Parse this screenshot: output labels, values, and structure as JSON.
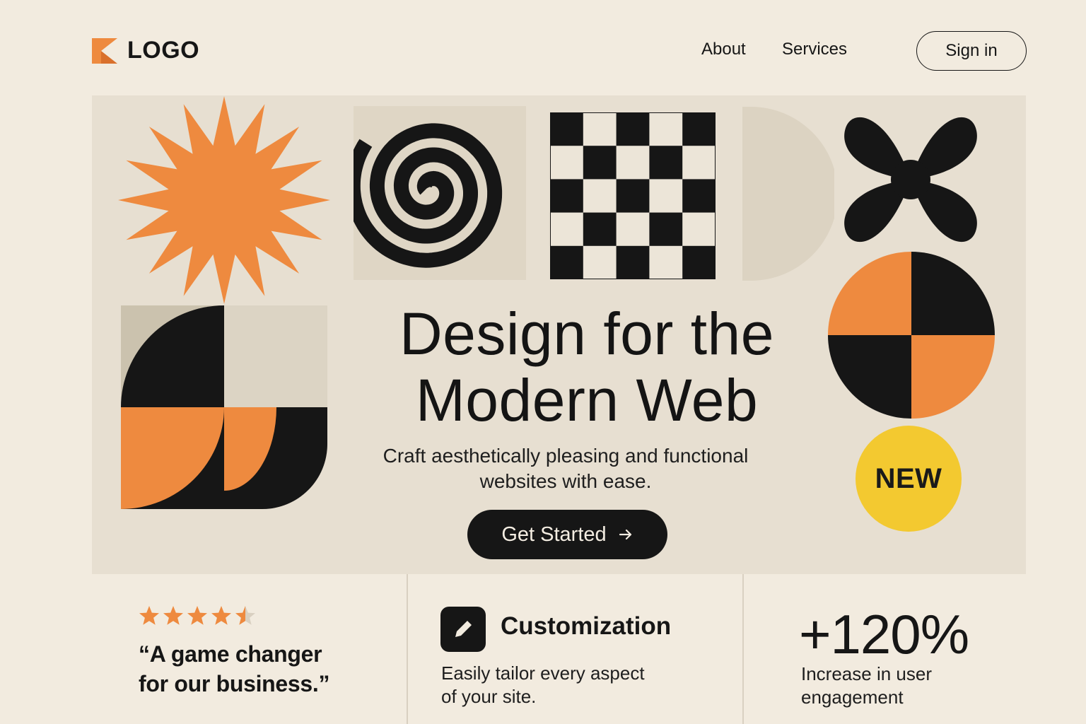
{
  "header": {
    "logo_text": "LOGO",
    "nav": [
      "About",
      "Services"
    ],
    "signin_label": "Sign in"
  },
  "hero": {
    "title_line1": "Design for the",
    "title_line2": "Modern Web",
    "subtitle_line1": "Craft aesthetically pleasing and functional",
    "subtitle_line2": "websites with ease.",
    "cta_label": "Get Started",
    "cta_icon": "arrow-right-icon",
    "badge": "NEW"
  },
  "features": {
    "rating": {
      "stars": 4.5,
      "max": 5,
      "quote_line1": "“A game changer",
      "quote_line2": "for our business.”"
    },
    "customization": {
      "icon": "edit-icon",
      "title": "Customization",
      "desc_line1": "Easily tailor every aspect",
      "desc_line2": "of your site."
    },
    "stat": {
      "value": "+120%",
      "label_line1": "Increase in user",
      "label_line2": "engagement"
    }
  },
  "colors": {
    "page_bg": "#f2ebdf",
    "hero_bg": "#e7dfd1",
    "accent_orange": "#ee8a3f",
    "ink": "#161616",
    "badge_yellow": "#f3c930",
    "beige": "#cbc2ae"
  }
}
